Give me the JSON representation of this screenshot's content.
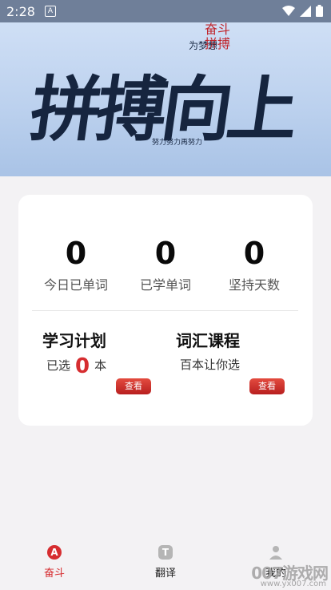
{
  "status_bar": {
    "time": "2:28",
    "app_badge": "A"
  },
  "banner": {
    "main_text": "拼搏向上",
    "sub_text": "为梦想",
    "red_text": "奋斗\n拼搏",
    "bottom_text": "努力努力再努力"
  },
  "stats": [
    {
      "value": "0",
      "label": "今日已单词"
    },
    {
      "value": "0",
      "label": "已学单词"
    },
    {
      "value": "0",
      "label": "坚持天数"
    }
  ],
  "study_plan": {
    "title": "学习计划",
    "prefix": "已选",
    "count": "0",
    "suffix": "本",
    "button": "查看"
  },
  "vocab_course": {
    "title": "词汇课程",
    "subtitle": "百本让你选",
    "button": "查看"
  },
  "nav": {
    "items": [
      {
        "label": "奋斗",
        "icon": "A",
        "active": true
      },
      {
        "label": "翻译",
        "icon": "T",
        "active": false
      },
      {
        "label": "我的",
        "icon": "",
        "active": false
      }
    ]
  },
  "watermark": {
    "main": "007游戏网",
    "small": "www.yx007.com"
  },
  "colors": {
    "accent": "#d62d30",
    "inactive": "#b5b5b5"
  }
}
